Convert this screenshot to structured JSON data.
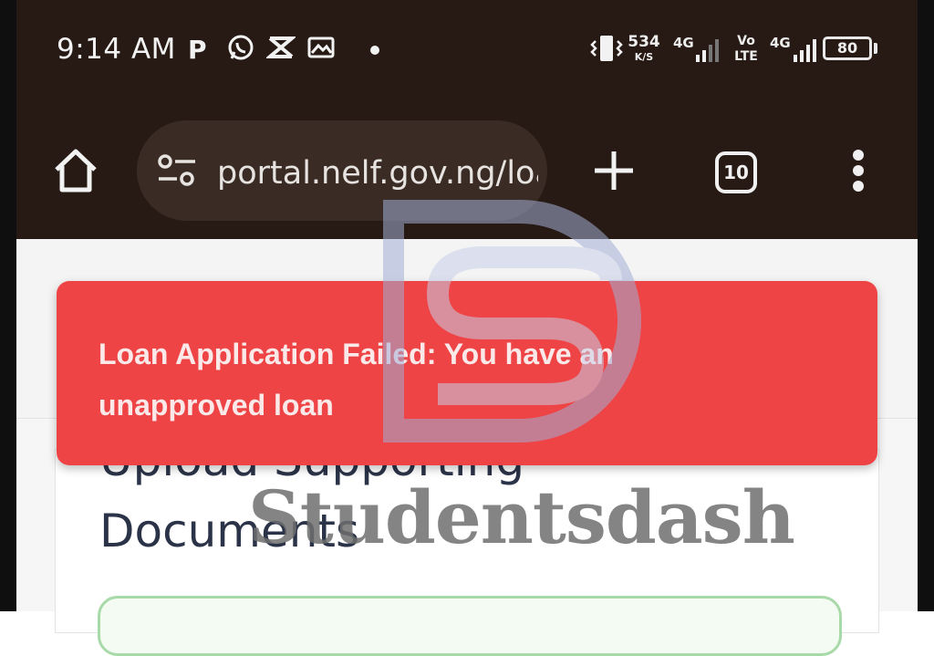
{
  "status_bar": {
    "time": "9:14 AM",
    "app_icon_p": "P",
    "notification_icons": [
      "p-icon",
      "whatsapp-icon",
      "capcut-icon",
      "gallery-icon",
      "dot-icon"
    ],
    "speed_value": "534",
    "speed_unit": "K/S",
    "network_1": "4G",
    "volte_top": "Vo",
    "volte_bottom": "LTE",
    "network_2": "4G",
    "battery": "80"
  },
  "browser": {
    "url": "portal.nelf.gov.ng/loa",
    "tab_count": "10"
  },
  "page": {
    "card_title_line1": "Upload Supporting",
    "card_title_line2": "Documents"
  },
  "toast": {
    "message": "Loan Application Failed: You have an unapproved loan",
    "color": "#ee4445"
  },
  "watermark": {
    "text": "Studentsdash"
  },
  "colors": {
    "toolbar_bg": "#271913",
    "url_pill_bg": "#3a2c25",
    "title_text": "#2b3348"
  }
}
